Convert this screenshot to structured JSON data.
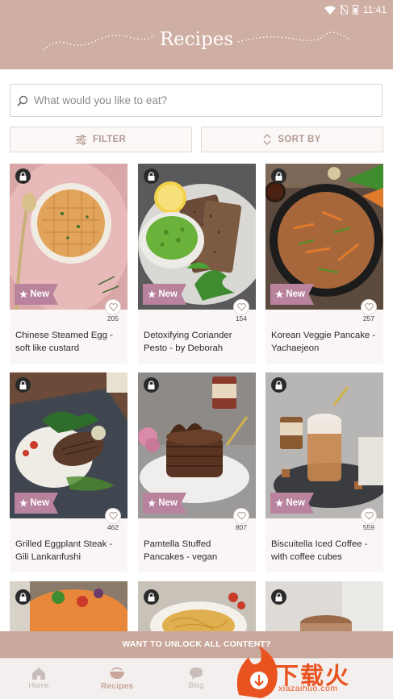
{
  "status_bar": {
    "time": "11:41"
  },
  "header": {
    "title": "Recipes"
  },
  "search": {
    "placeholder": "What would you like to eat?"
  },
  "toolbar": {
    "filter_label": "FILTER",
    "sort_label": "SORT BY"
  },
  "badge": {
    "new_label": "New"
  },
  "recipes": [
    {
      "name": "Chinese Steamed Egg - soft like custard",
      "count": "205",
      "locked": true,
      "new": true
    },
    {
      "name": "Detoxifying Coriander Pesto - by Deborah",
      "count": "154",
      "locked": true,
      "new": true
    },
    {
      "name": "Korean Veggie Pancake - Yachaejeon",
      "count": "257",
      "locked": true,
      "new": true
    },
    {
      "name": "Grilled Eggplant Steak - Gili Lankanfushi",
      "count": "462",
      "locked": true,
      "new": true
    },
    {
      "name": "Pamtella Stuffed Pancakes - vegan",
      "count": "807",
      "locked": true,
      "new": true
    },
    {
      "name": "Biscuitella Iced Coffee - with coffee cubes",
      "count": "559",
      "locked": true,
      "new": true
    }
  ],
  "unlock_banner": {
    "text": "WANT TO UNLOCK ALL CONTENT?"
  },
  "tabbar": {
    "tabs": [
      {
        "label": "Home",
        "icon": "home-icon",
        "active": false
      },
      {
        "label": "Recipes",
        "icon": "bowl-icon",
        "active": true
      },
      {
        "label": "Blog",
        "icon": "chat-bubble-icon",
        "active": false
      }
    ]
  },
  "watermark": {
    "text": "下载火",
    "url": "xiazaihuo.com"
  },
  "colors": {
    "header": "#cfaea4",
    "accent": "#c8a699",
    "new_badge": "#b9839d",
    "watermark": "#e9531f"
  }
}
